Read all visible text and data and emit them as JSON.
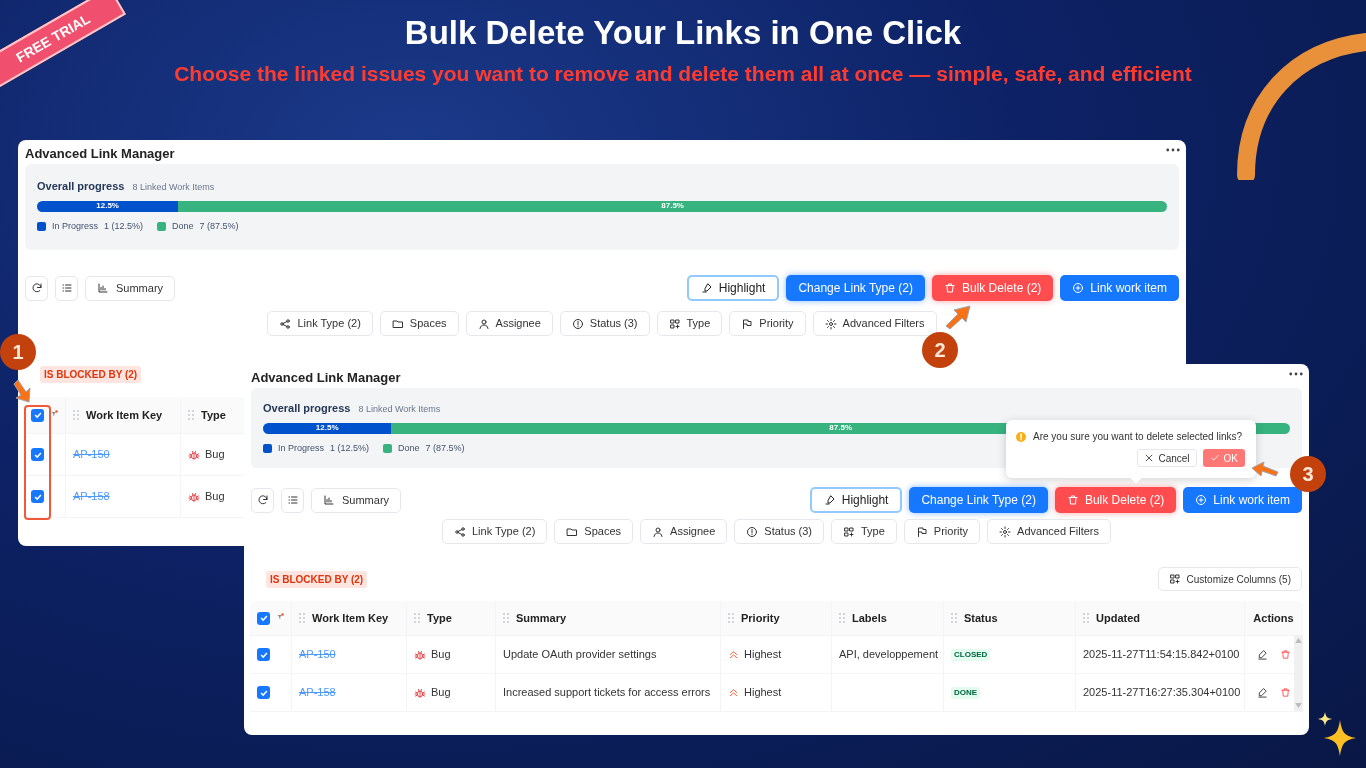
{
  "promo": {
    "ribbon": "FREE TRIAL",
    "headline": "Bulk Delete Your Links in One Click",
    "subheadline": "Choose the linked issues you want to remove and delete them all at once — simple, safe, and efficient"
  },
  "steps": [
    "1",
    "2",
    "3"
  ],
  "windows": [
    {
      "title": "Advanced Link Manager",
      "progress": {
        "label": "Overall progress",
        "count": "8 Linked Work Items",
        "segments": [
          {
            "name": "In Progress",
            "value": "1 (12.5%)",
            "label": "12.5%",
            "level": 0.125,
            "color": "#0052cc"
          },
          {
            "name": "Done",
            "value": "7 (87.5%)",
            "label": "87.5%",
            "level": 0.875,
            "color": "#36b37e"
          }
        ]
      },
      "tools": [
        {
          "kind": "refresh"
        },
        {
          "kind": "list"
        },
        {
          "kind": "summary",
          "label": "Summary"
        }
      ],
      "actions": [
        {
          "kind": "highlight",
          "label": "Highlight"
        },
        {
          "kind": "primary",
          "label": "Change Link Type (2)"
        },
        {
          "kind": "danger",
          "label": "Bulk Delete (2)"
        },
        {
          "kind": "add",
          "label": "Link work item"
        }
      ],
      "filters": [
        {
          "kind": "link",
          "label": "Link Type (2)"
        },
        {
          "kind": "folder",
          "label": "Spaces"
        },
        {
          "kind": "user",
          "label": "Assignee"
        },
        {
          "kind": "status",
          "label": "Status (3)"
        },
        {
          "kind": "grid",
          "label": "Type"
        },
        {
          "kind": "flag",
          "label": "Priority"
        },
        {
          "kind": "gear",
          "label": "Advanced Filters"
        }
      ],
      "group_tag": "IS BLOCKED BY (2)",
      "table": {
        "all_selected": true,
        "columns": [
          {
            "kind": "select"
          },
          {
            "kind": "key",
            "label": "Work Item Key"
          },
          {
            "kind": "type",
            "label": "Type"
          }
        ],
        "rows": [
          {
            "selected": true,
            "key": "AP-150",
            "type": "Bug"
          },
          {
            "selected": true,
            "key": "AP-158",
            "type": "Bug"
          }
        ]
      }
    },
    {
      "title": "Advanced Link Manager",
      "progress": {
        "label": "Overall progress",
        "count": "8 Linked Work Items",
        "segments": [
          {
            "name": "In Progress",
            "value": "1 (12.5%)",
            "label": "12.5%",
            "level": 0.125,
            "color": "#0052cc"
          },
          {
            "name": "Done",
            "value": "7 (87.5%)",
            "label": "87.5%",
            "level": 0.875,
            "color": "#36b37e"
          }
        ]
      },
      "tools": [
        {
          "kind": "refresh"
        },
        {
          "kind": "list"
        },
        {
          "kind": "summary",
          "label": "Summary"
        }
      ],
      "actions": [
        {
          "kind": "highlight",
          "label": "Highlight"
        },
        {
          "kind": "primary",
          "label": "Change Link Type (2)"
        },
        {
          "kind": "danger",
          "label": "Bulk Delete (2)"
        },
        {
          "kind": "add",
          "label": "Link work item"
        }
      ],
      "filters": [
        {
          "kind": "link",
          "label": "Link Type (2)"
        },
        {
          "kind": "folder",
          "label": "Spaces"
        },
        {
          "kind": "user",
          "label": "Assignee"
        },
        {
          "kind": "status",
          "label": "Status (3)"
        },
        {
          "kind": "grid",
          "label": "Type"
        },
        {
          "kind": "flag",
          "label": "Priority"
        },
        {
          "kind": "gear",
          "label": "Advanced Filters"
        }
      ],
      "group_tag": "IS BLOCKED BY (2)",
      "customize": "Customize Columns (5)",
      "confirm": {
        "message": "Are you sure you want to delete selected links?",
        "cancel": "Cancel",
        "ok": "OK"
      },
      "table": {
        "all_selected": true,
        "columns": [
          {
            "kind": "select"
          },
          {
            "kind": "key",
            "label": "Work Item Key"
          },
          {
            "kind": "type",
            "label": "Type"
          },
          {
            "kind": "summary",
            "label": "Summary"
          },
          {
            "kind": "priority",
            "label": "Priority"
          },
          {
            "kind": "labels",
            "label": "Labels"
          },
          {
            "kind": "status",
            "label": "Status"
          },
          {
            "kind": "updated",
            "label": "Updated"
          },
          {
            "kind": "actions",
            "label": "Actions"
          }
        ],
        "rows": [
          {
            "selected": true,
            "key": "AP-150",
            "type": "Bug",
            "summary": "Update OAuth provider settings",
            "priority": "Highest",
            "labels": "API, developpement",
            "status": "CLOSED",
            "updated": "2025-11-27T11:54:15.842+0100"
          },
          {
            "selected": true,
            "key": "AP-158",
            "type": "Bug",
            "summary": "Increased support tickets for access errors",
            "priority": "Highest",
            "status": "DONE",
            "updated": "2025-11-27T16:27:35.304+0100"
          }
        ]
      }
    }
  ]
}
